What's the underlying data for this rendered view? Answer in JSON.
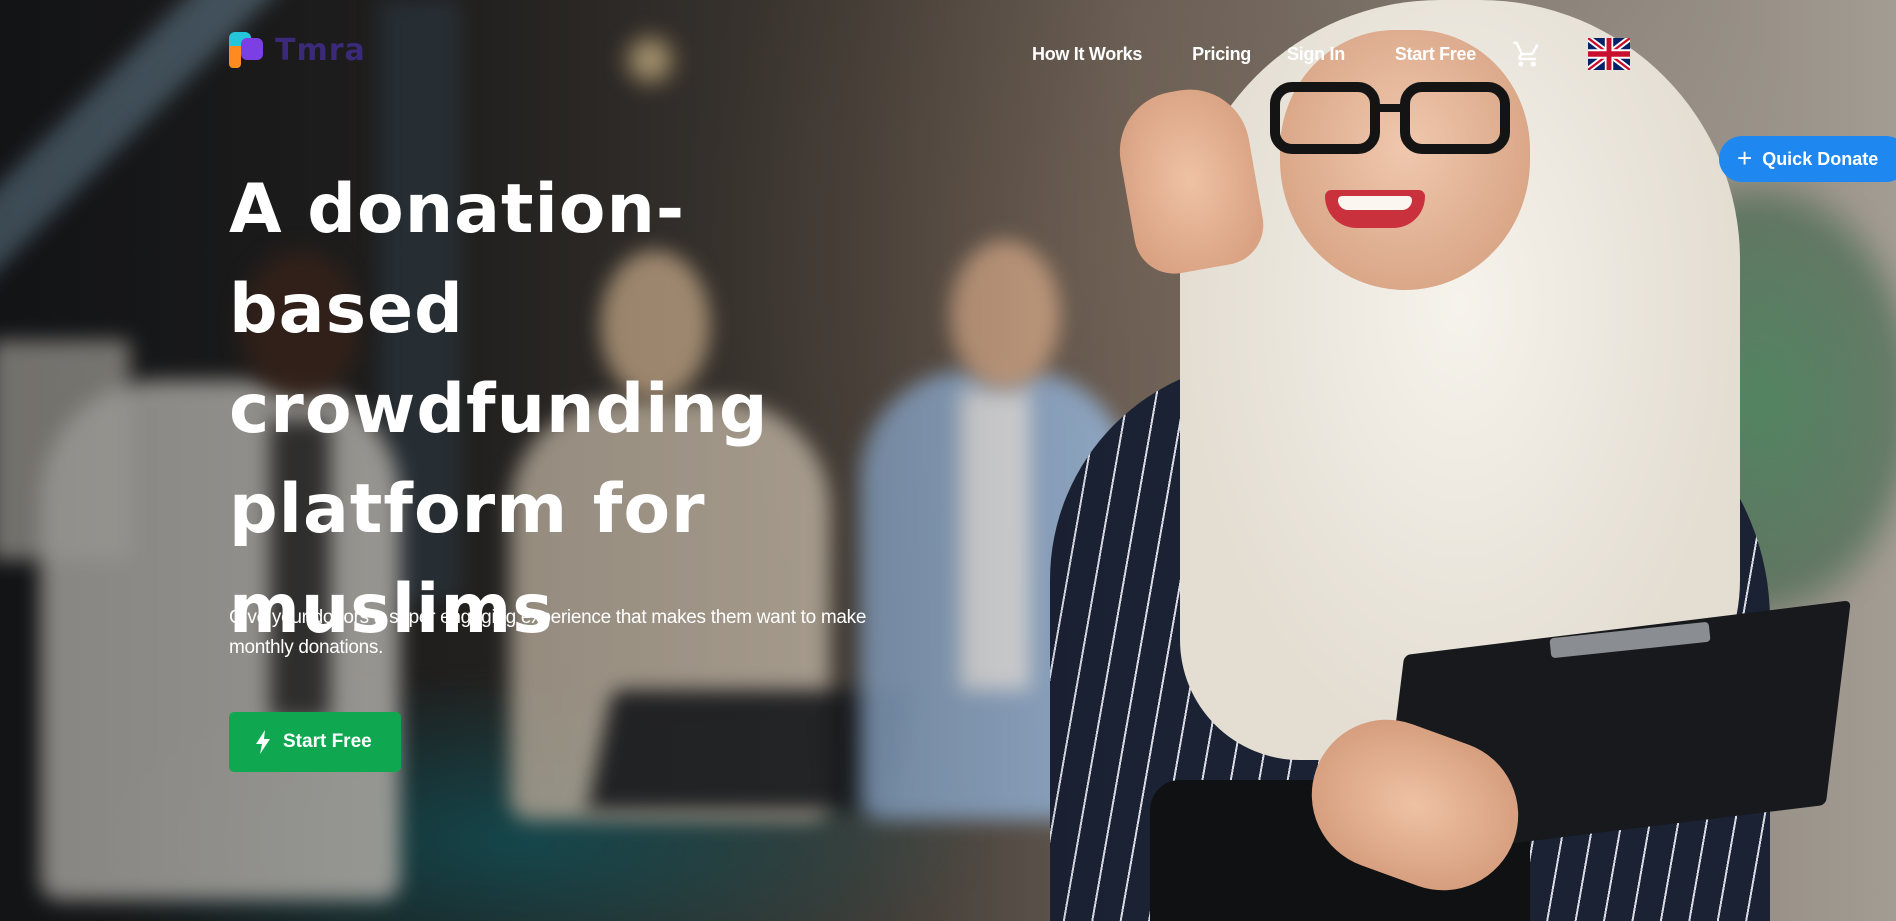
{
  "brand": {
    "name": "Tmra"
  },
  "nav": {
    "items": [
      {
        "label": "How It Works"
      },
      {
        "label": "Pricing"
      },
      {
        "label": "Sign In"
      },
      {
        "label": "Start Free"
      }
    ],
    "cart_icon": "cart-icon",
    "language_icon": "uk-flag-icon"
  },
  "quick_donate": {
    "label": "Quick Donate",
    "icon": "plus-icon"
  },
  "hero": {
    "title": "A donation-based crowdfunding platform for muslims",
    "subtitle": "Give your donors a super engaging experience that makes them want to make monthly donations.",
    "cta_label": "Start Free",
    "cta_icon": "lightning-bolt-icon"
  },
  "colors": {
    "cta_green": "#0fa851",
    "quick_donate_blue": "#1e88f0",
    "logo_purple": "#3b2a7a",
    "text": "#ffffff"
  }
}
